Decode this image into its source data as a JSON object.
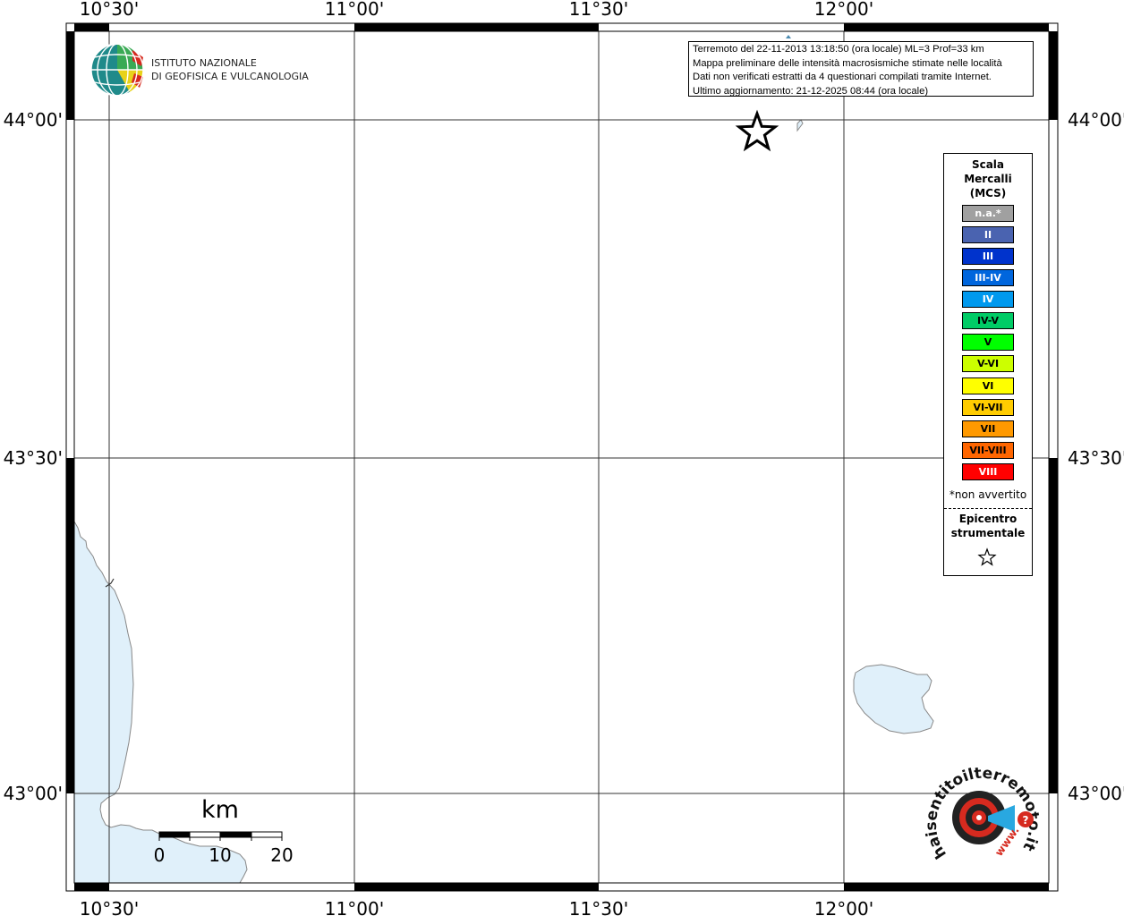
{
  "map": {
    "title": "",
    "graticule": {
      "longitude_labels": [
        "10°30'",
        "11°00'",
        "11°30'",
        "12°00'"
      ],
      "latitude_labels": [
        "44°00'",
        "43°30'",
        "43°00'"
      ]
    },
    "logo": {
      "line1": "ISTITUTO NAZIONALE",
      "line2": "DI GEOFISICA E VULCANOLOGIA"
    },
    "info": {
      "line1": "Terremoto del 22-11-2013 13:18:50 (ora locale) ML=3 Prof=33 km",
      "line2": "Mappa preliminare delle intensità macrosismiche stimate nelle località",
      "line3": "Dati non verificati estratti da 4 questionari compilati tramite Internet.",
      "line4": "Ultimo aggiornamento: 21-12-2025 08:44 (ora locale)"
    },
    "scale_bar": {
      "unit": "km",
      "ticks": [
        "0",
        "10",
        "20"
      ]
    },
    "water_color": "#e0f0fa",
    "coast_color": "#888888"
  },
  "legend": {
    "title_lines": [
      "Scala",
      "Mercalli",
      "(MCS)"
    ],
    "classes": [
      {
        "label": "n.a.*",
        "color": "#a0a0a0",
        "text_color": "#ffffff"
      },
      {
        "label": "II",
        "color": "#4a63b0",
        "text_color": "#ffffff"
      },
      {
        "label": "III",
        "color": "#0033cc",
        "text_color": "#ffffff"
      },
      {
        "label": "III-IV",
        "color": "#0066dd",
        "text_color": "#ffffff"
      },
      {
        "label": "IV",
        "color": "#0099ee",
        "text_color": "#ffffff"
      },
      {
        "label": "IV-V",
        "color": "#00cc66",
        "text_color": "#000000"
      },
      {
        "label": "V",
        "color": "#00ff00",
        "text_color": "#000000"
      },
      {
        "label": "V-VI",
        "color": "#ccff00",
        "text_color": "#000000"
      },
      {
        "label": "VI",
        "color": "#ffff00",
        "text_color": "#000000"
      },
      {
        "label": "VI-VII",
        "color": "#ffcc00",
        "text_color": "#000000"
      },
      {
        "label": "VII",
        "color": "#ff9900",
        "text_color": "#000000"
      },
      {
        "label": "VII-VIII",
        "color": "#ff6600",
        "text_color": "#000000"
      },
      {
        "label": "VIII",
        "color": "#ff0000",
        "text_color": "#ffffff"
      }
    ],
    "note": "*non avvertito",
    "epicenter_lines": [
      "Epicentro",
      "strumentale"
    ],
    "epicenter_icon": "star-outline-icon"
  },
  "badge": {
    "text": "haisentitoilterremoto.it",
    "url_text": "www.",
    "icon": "seismograph-target-icon"
  }
}
